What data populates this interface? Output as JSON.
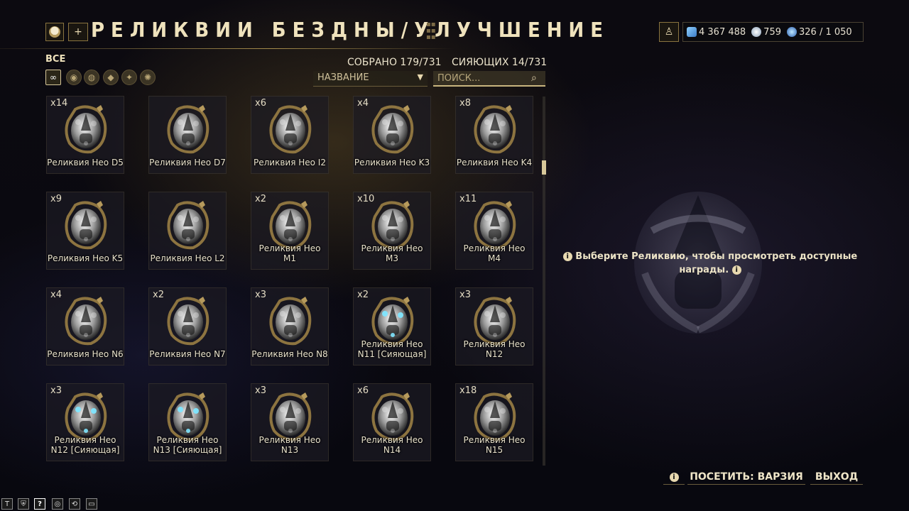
{
  "header": {
    "title": "РЕЛИКВИИ БЕЗДНЫ/УЛУЧШЕНИЕ",
    "add_label": "+",
    "avatar_icon": "skull-avatar-icon"
  },
  "currencies": {
    "credits": "4 367 488",
    "platinum": "759",
    "void_traces": "326 / 1 050"
  },
  "filters": {
    "label": "ВСЕ",
    "items": [
      "all-infinity-icon",
      "lith-icon",
      "meso-icon",
      "neo-icon",
      "axi-icon",
      "requiem-icon"
    ]
  },
  "stats": {
    "collected": "СОБРАНО 179/731",
    "radiant": "СИЯЮЩИХ 14/731"
  },
  "sort": {
    "value": "НАЗВАНИЕ"
  },
  "search": {
    "placeholder": "ПОИСК..."
  },
  "relics": [
    {
      "count": "x14",
      "name": "Реликвия Нео D5",
      "radiant": false
    },
    {
      "count": "",
      "name": "Реликвия Нео D7",
      "radiant": false
    },
    {
      "count": "x6",
      "name": "Реликвия Нео I2",
      "radiant": false
    },
    {
      "count": "x4",
      "name": "Реликвия Нео K3",
      "radiant": false
    },
    {
      "count": "x8",
      "name": "Реликвия Нео K4",
      "radiant": false
    },
    {
      "count": "x9",
      "name": "Реликвия Нео K5",
      "radiant": false
    },
    {
      "count": "",
      "name": "Реликвия Нео L2",
      "radiant": false
    },
    {
      "count": "x2",
      "name": "Реликвия Нео M1",
      "radiant": false
    },
    {
      "count": "x10",
      "name": "Реликвия Нео M3",
      "radiant": false
    },
    {
      "count": "x11",
      "name": "Реликвия Нео M4",
      "radiant": false
    },
    {
      "count": "x4",
      "name": "Реликвия Нео N6",
      "radiant": false
    },
    {
      "count": "x2",
      "name": "Реликвия Нео N7",
      "radiant": false
    },
    {
      "count": "x3",
      "name": "Реликвия Нео N8",
      "radiant": false
    },
    {
      "count": "x2",
      "name": "Реликвия Нео N11 [Сияющая]",
      "radiant": true
    },
    {
      "count": "x3",
      "name": "Реликвия Нео N12",
      "radiant": false
    },
    {
      "count": "x3",
      "name": "Реликвия Нео N12 [Сияющая]",
      "radiant": true
    },
    {
      "count": "",
      "name": "Реликвия Нео N13 [Сияющая]",
      "radiant": true
    },
    {
      "count": "x3",
      "name": "Реликвия Нео N13",
      "radiant": false
    },
    {
      "count": "x6",
      "name": "Реликвия Нео N14",
      "radiant": false
    },
    {
      "count": "x18",
      "name": "Реликвия Нео N15",
      "radiant": false
    }
  ],
  "details": {
    "hint": "Выберите Реликвию, чтобы просмотреть доступные награды."
  },
  "bottom": {
    "info_icon": "info-icon",
    "visit_label": "ПОСЕТИТЬ: ВАРЗИЯ",
    "exit_label": "ВЫХОД"
  },
  "tray": {
    "items": [
      "T",
      "shield-icon",
      "?",
      "chat-icon",
      "refresh-icon",
      "window-icon"
    ]
  },
  "colors": {
    "accent_gold": "#d8c89a",
    "radiant_cyan": "#7fe6ff"
  }
}
